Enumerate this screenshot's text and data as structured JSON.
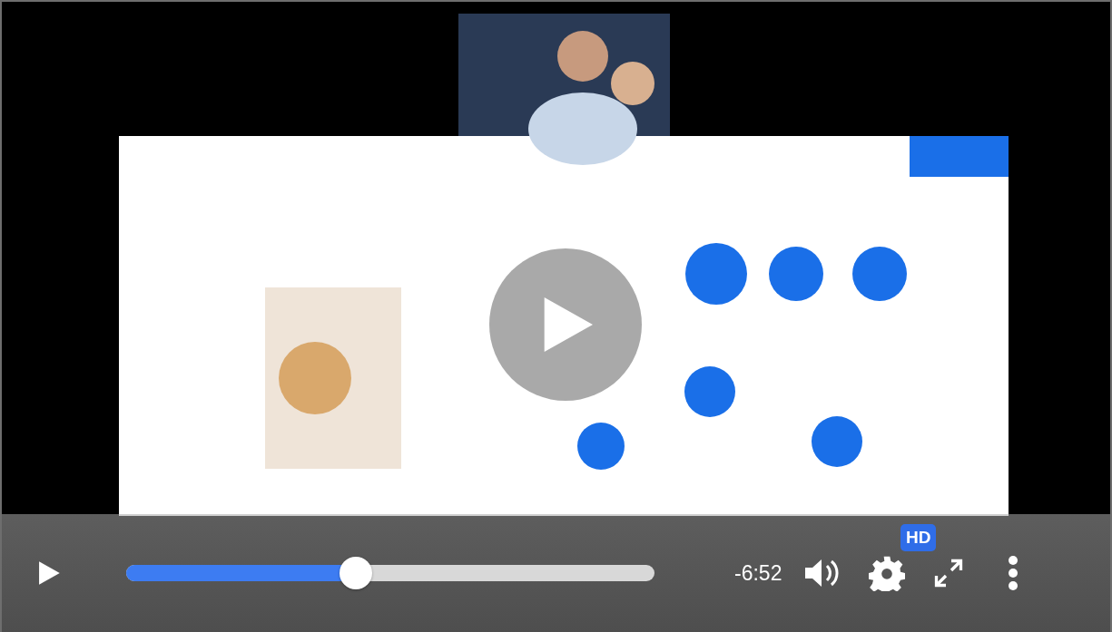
{
  "player": {
    "playing": false,
    "progress": {
      "level": 0.435
    },
    "time_remaining": "-6:52",
    "quality_badge": "HD"
  }
}
